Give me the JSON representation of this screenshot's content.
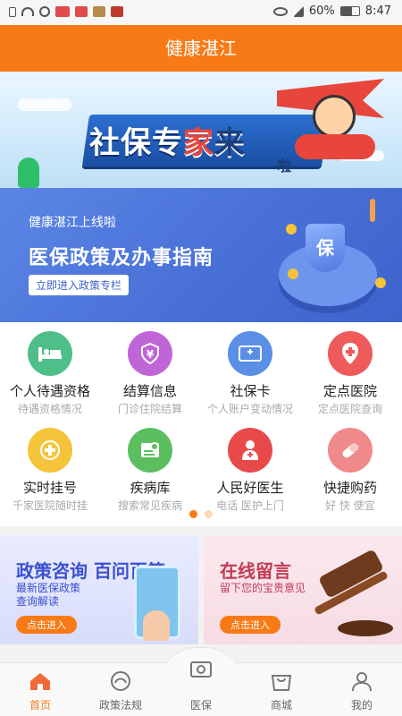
{
  "status_bar": {
    "battery": "60%",
    "time": "8:47"
  },
  "app": {
    "title": "健康湛江"
  },
  "banner1": {
    "title_part1": "社保专",
    "title_part2": "家",
    "title_part3": "来",
    "title_part4": "啦"
  },
  "banner2": {
    "line1": "健康湛江上线啦",
    "headline": "医保政策及办事指南",
    "button": "立即进入政策专栏",
    "shield_text": "保"
  },
  "services": [
    {
      "label": "个人待遇资格",
      "sub": "待遇资格情况",
      "icon": "bed-icon",
      "color": "#4fbf8a"
    },
    {
      "label": "结算信息",
      "sub": "门诊住院结算",
      "icon": "yen-icon",
      "color": "#c065d8"
    },
    {
      "label": "社保卡",
      "sub": "个人账户变动情况",
      "icon": "card-icon",
      "color": "#5b8fe6"
    },
    {
      "label": "定点医院",
      "sub": "定点医院查询",
      "icon": "location-cross-icon",
      "color": "#ef5a5a"
    },
    {
      "label": "实时挂号",
      "sub": "千家医院随时挂",
      "icon": "plus-badge-icon",
      "color": "#f5c43a"
    },
    {
      "label": "疾病库",
      "sub": "搜索常见疾病",
      "icon": "document-icon",
      "color": "#5bbf5f"
    },
    {
      "label": "人民好医生",
      "sub": "电话 医护上门",
      "icon": "doctor-icon",
      "color": "#e84a4a"
    },
    {
      "label": "快捷购药",
      "sub": "好 快 便宜",
      "icon": "pill-icon",
      "color": "#f08a8a"
    }
  ],
  "promos": {
    "left": {
      "title": "政策咨询 百问百答",
      "desc1": "最新医保政策",
      "desc2": "查询解读",
      "button": "点击进入"
    },
    "right": {
      "title": "在线留言",
      "desc1": "留下您的宝贵意见",
      "button": "点击进入"
    }
  },
  "tabbar": [
    {
      "label": "首页",
      "icon": "home-icon",
      "active": true
    },
    {
      "label": "政策法规",
      "icon": "policy-icon",
      "active": false
    },
    {
      "label": "医保",
      "icon": "medical-insurance-icon",
      "active": false
    },
    {
      "label": "商城",
      "icon": "shopping-bag-icon",
      "active": false
    },
    {
      "label": "我的",
      "icon": "person-icon",
      "active": false
    }
  ]
}
